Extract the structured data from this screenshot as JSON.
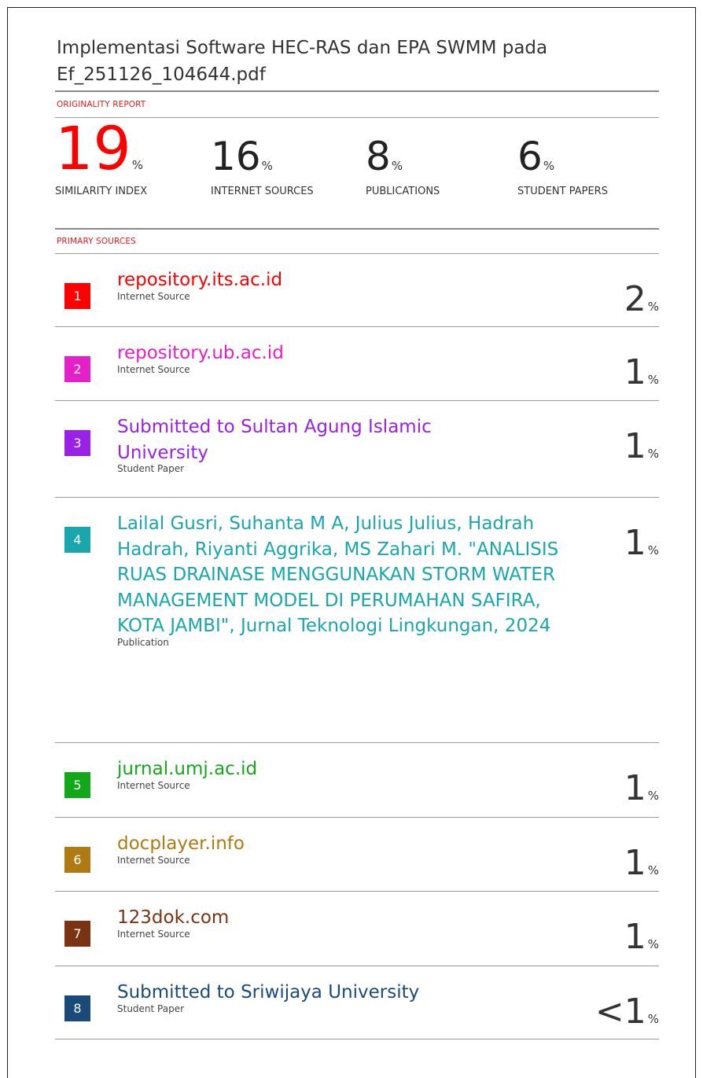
{
  "title": "Implementasi Software HEC-RAS dan EPA SWMM pada Ef_251126_104644.pdf",
  "originality_label": "ORIGINALITY REPORT",
  "primary_label": "PRIMARY SOURCES",
  "stats": [
    {
      "value": "19",
      "unit": "%",
      "label": "SIMILARITY INDEX"
    },
    {
      "value": "16",
      "unit": "%",
      "label": "INTERNET SOURCES"
    },
    {
      "value": "8",
      "unit": "%",
      "label": "PUBLICATIONS"
    },
    {
      "value": "6",
      "unit": "%",
      "label": "STUDENT PAPERS"
    }
  ],
  "sources": [
    {
      "rank": "1",
      "name": "repository.its.ac.id",
      "type": "Internet Source",
      "pct": "2",
      "unit": "%",
      "color": "#ff0000"
    },
    {
      "rank": "2",
      "name": "repository.ub.ac.id",
      "type": "Internet Source",
      "pct": "1",
      "unit": "%",
      "color": "#e620c8"
    },
    {
      "rank": "3",
      "name": "Submitted to Sultan Agung Islamic University",
      "type": "Student Paper",
      "pct": "1",
      "unit": "%",
      "color": "#9a22e6"
    },
    {
      "rank": "4",
      "name": "Lailal Gusri, Suhanta M A, Julius Julius, Hadrah Hadrah, Riyanti Aggrika, MS Zahari M. \"ANALISIS RUAS DRAINASE MENGGUNAKAN STORM WATER MANAGEMENT MODEL DI PERUMAHAN SAFIRA, KOTA JAMBI\", Jurnal Teknologi Lingkungan, 2024",
      "type": "Publication",
      "pct": "1",
      "unit": "%",
      "color": "#1aa6ad"
    },
    {
      "rank": "5",
      "name": "jurnal.umj.ac.id",
      "type": "Internet Source",
      "pct": "1",
      "unit": "%",
      "color": "#12a81a"
    },
    {
      "rank": "6",
      "name": "docplayer.info",
      "type": "Internet Source",
      "pct": "1",
      "unit": "%",
      "color": "#b07a12"
    },
    {
      "rank": "7",
      "name": "123dok.com",
      "type": "Internet Source",
      "pct": "1",
      "unit": "%",
      "color": "#7a3414"
    },
    {
      "rank": "8",
      "name": "Submitted to Sriwijaya University",
      "type": "Student Paper",
      "pct": "<1",
      "unit": "%",
      "color": "#1a4a7a"
    }
  ]
}
